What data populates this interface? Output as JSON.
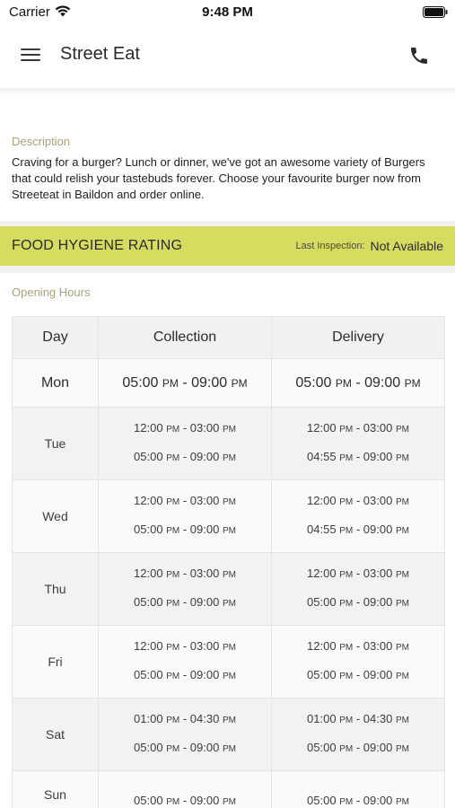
{
  "status_bar": {
    "carrier": "Carrier",
    "time": "9:48 PM"
  },
  "header": {
    "title": "Street Eat"
  },
  "description": {
    "label": "Description",
    "text": "Craving for a burger? Lunch or dinner, we've got an awesome variety of Burgers that could relish your tastebuds forever. Choose your favourite burger now from Streeteat in Baildon and order online."
  },
  "hygiene": {
    "title": "FOOD HYGIENE RATING",
    "inspection_label": "Last Inspection:",
    "inspection_value": "Not Available"
  },
  "opening_hours": {
    "label": "Opening Hours",
    "headers": {
      "day": "Day",
      "collection": "Collection",
      "delivery": "Delivery"
    },
    "rows": [
      {
        "day": "Mon",
        "collection": [
          {
            "start": "05:00",
            "start_ampm": "PM",
            "end": "09:00",
            "end_ampm": "PM"
          }
        ],
        "delivery": [
          {
            "start": "05:00",
            "start_ampm": "PM",
            "end": "09:00",
            "end_ampm": "PM"
          }
        ]
      },
      {
        "day": "Tue",
        "collection": [
          {
            "start": "12:00",
            "start_ampm": "PM",
            "end": "03:00",
            "end_ampm": "PM"
          },
          {
            "start": "05:00",
            "start_ampm": "PM",
            "end": "09:00",
            "end_ampm": "PM"
          }
        ],
        "delivery": [
          {
            "start": "12:00",
            "start_ampm": "PM",
            "end": "03:00",
            "end_ampm": "PM"
          },
          {
            "start": "04:55",
            "start_ampm": "PM",
            "end": "09:00",
            "end_ampm": "PM"
          }
        ]
      },
      {
        "day": "Wed",
        "collection": [
          {
            "start": "12:00",
            "start_ampm": "PM",
            "end": "03:00",
            "end_ampm": "PM"
          },
          {
            "start": "05:00",
            "start_ampm": "PM",
            "end": "09:00",
            "end_ampm": "PM"
          }
        ],
        "delivery": [
          {
            "start": "12:00",
            "start_ampm": "PM",
            "end": "03:00",
            "end_ampm": "PM"
          },
          {
            "start": "04:55",
            "start_ampm": "PM",
            "end": "09:00",
            "end_ampm": "PM"
          }
        ]
      },
      {
        "day": "Thu",
        "collection": [
          {
            "start": "12:00",
            "start_ampm": "PM",
            "end": "03:00",
            "end_ampm": "PM"
          },
          {
            "start": "05:00",
            "start_ampm": "PM",
            "end": "09:00",
            "end_ampm": "PM"
          }
        ],
        "delivery": [
          {
            "start": "12:00",
            "start_ampm": "PM",
            "end": "03:00",
            "end_ampm": "PM"
          },
          {
            "start": "05:00",
            "start_ampm": "PM",
            "end": "09:00",
            "end_ampm": "PM"
          }
        ]
      },
      {
        "day": "Fri",
        "collection": [
          {
            "start": "12:00",
            "start_ampm": "PM",
            "end": "03:00",
            "end_ampm": "PM"
          },
          {
            "start": "05:00",
            "start_ampm": "PM",
            "end": "09:00",
            "end_ampm": "PM"
          }
        ],
        "delivery": [
          {
            "start": "12:00",
            "start_ampm": "PM",
            "end": "03:00",
            "end_ampm": "PM"
          },
          {
            "start": "05:00",
            "start_ampm": "PM",
            "end": "09:00",
            "end_ampm": "PM"
          }
        ]
      },
      {
        "day": "Sat",
        "collection": [
          {
            "start": "01:00",
            "start_ampm": "PM",
            "end": "04:30",
            "end_ampm": "PM"
          },
          {
            "start": "05:00",
            "start_ampm": "PM",
            "end": "09:00",
            "end_ampm": "PM"
          }
        ],
        "delivery": [
          {
            "start": "01:00",
            "start_ampm": "PM",
            "end": "04:30",
            "end_ampm": "PM"
          },
          {
            "start": "05:00",
            "start_ampm": "PM",
            "end": "09:00",
            "end_ampm": "PM"
          }
        ]
      },
      {
        "day": "Sun",
        "collection": [
          {
            "start": "05:00",
            "start_ampm": "PM",
            "end": "09:00",
            "end_ampm": "PM"
          }
        ],
        "delivery": [
          {
            "start": "05:00",
            "start_ampm": "PM",
            "end": "09:00",
            "end_ampm": "PM"
          }
        ]
      }
    ]
  }
}
